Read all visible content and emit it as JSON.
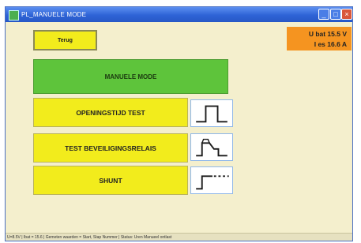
{
  "window": {
    "title": "PL_MANUELE MODE",
    "buttons": {
      "minimize": "_",
      "maximize": "□",
      "close": "×"
    }
  },
  "toolbar": {
    "back_label": "Terug"
  },
  "status": {
    "ubat": "U bat 15.5 V",
    "ies": "I es 16.6 A"
  },
  "main": {
    "heading": "MANUELE MODE"
  },
  "functions": {
    "opening": "OPENINGSTIJD TEST",
    "relais": "TEST BEVEILIGINGSRELAIS",
    "shunt": "SHUNT"
  },
  "icons": {
    "opening_wave": "pulse-waveform-icon",
    "relais_wave": "step-waveform-icon",
    "shunt_wave": "step-dashed-waveform-icon"
  },
  "statusbar": {
    "text": "U=8.5V | Ibat = 15.6 | Gemeten waarden = Start, Stap Nummer | Status: Uren Manueel ontlast"
  },
  "colors": {
    "button_yellow": "#f2ec1c",
    "heading_green": "#5ec43b",
    "status_orange": "#f59420",
    "titlebar_blue": "#2e63d6"
  }
}
